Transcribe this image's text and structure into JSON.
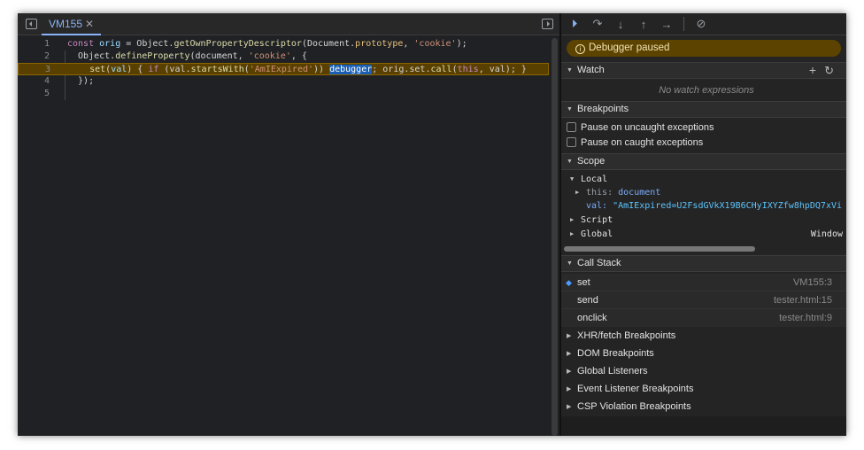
{
  "editor": {
    "tab_label": "VM155",
    "lines": [
      {
        "n": "1"
      },
      {
        "n": "2"
      },
      {
        "n": "3"
      },
      {
        "n": "4"
      },
      {
        "n": "5"
      }
    ],
    "code_text": [
      "const orig = Object.getOwnPropertyDescriptor(Document.prototype, 'cookie');",
      "Object.defineProperty(document, 'cookie', {",
      "set(val) { if (val.startsWith('AmIExpired')) debugger; orig.set.call(this, val); }",
      "});",
      ""
    ],
    "paused_line": 3
  },
  "sidebar": {
    "toolbar": [
      "resume-icon",
      "step-over-icon",
      "step-into-icon",
      "step-out-icon",
      "step-icon",
      "deactivate-breakpoints-icon"
    ],
    "paused_banner": "Debugger paused",
    "watch": {
      "title": "Watch",
      "empty": "No watch expressions"
    },
    "breakpoints": {
      "title": "Breakpoints",
      "options": [
        {
          "label": "Pause on uncaught exceptions",
          "checked": false
        },
        {
          "label": "Pause on caught exceptions",
          "checked": false
        }
      ]
    },
    "scope": {
      "title": "Scope",
      "local": "Local",
      "this_key": "this:",
      "this_val": "document",
      "val_key": "val:",
      "val_val": "\"AmIExpired=U2FsdGVkX19B6CHyIXYZfw8hpDQ7xVi",
      "script": "Script",
      "global": "Global",
      "global_val": "Window"
    },
    "call_stack": {
      "title": "Call Stack",
      "frames": [
        {
          "name": "set",
          "loc": "VM155:3"
        },
        {
          "name": "send",
          "loc": "tester.html:15"
        },
        {
          "name": "onclick",
          "loc": "tester.html:9"
        }
      ]
    },
    "sections": [
      "XHR/fetch Breakpoints",
      "DOM Breakpoints",
      "Global Listeners",
      "Event Listener Breakpoints",
      "CSP Violation Breakpoints"
    ]
  }
}
